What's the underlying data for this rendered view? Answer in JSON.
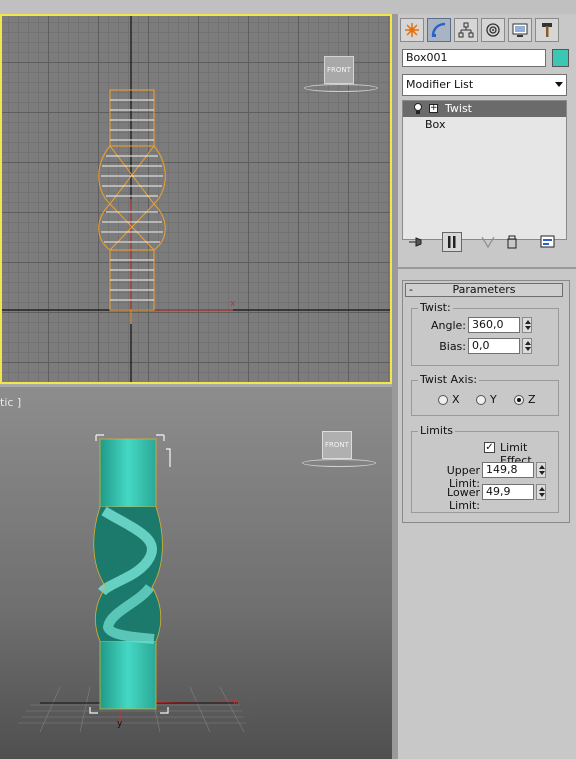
{
  "viewports": {
    "top_label": "",
    "persp_label": "tic ]",
    "viewcube_label": "FRONT",
    "axis_x": "x",
    "axis_y": "y"
  },
  "command_panel": {
    "tabs": [
      "create-icon",
      "modify-icon",
      "hierarchy-icon",
      "motion-icon",
      "display-icon",
      "utilities-icon"
    ],
    "active_tab": "modify",
    "object_name": "Box001",
    "object_color": "#3cc7b2",
    "modifier_list": "Modifier List",
    "stack": [
      {
        "label": "Twist",
        "selected": true
      },
      {
        "label": "Box",
        "selected": false
      }
    ]
  },
  "parameters": {
    "rollout_title": "Parameters",
    "collapse": "-",
    "twist_group": "Twist:",
    "angle_label": "Angle:",
    "angle_value": "360,0",
    "bias_label": "Bias:",
    "bias_value": "0,0",
    "axis_group": "Twist Axis:",
    "axis_x": "X",
    "axis_y": "Y",
    "axis_z": "Z",
    "axis_selected": "Z",
    "limits_group": "Limits",
    "limit_effect": "Limit Effect",
    "limit_effect_checked": true,
    "upper_label": "Upper Limit:",
    "upper_value": "149,8",
    "lower_label": "Lower Limit:",
    "lower_value": "49,9"
  }
}
